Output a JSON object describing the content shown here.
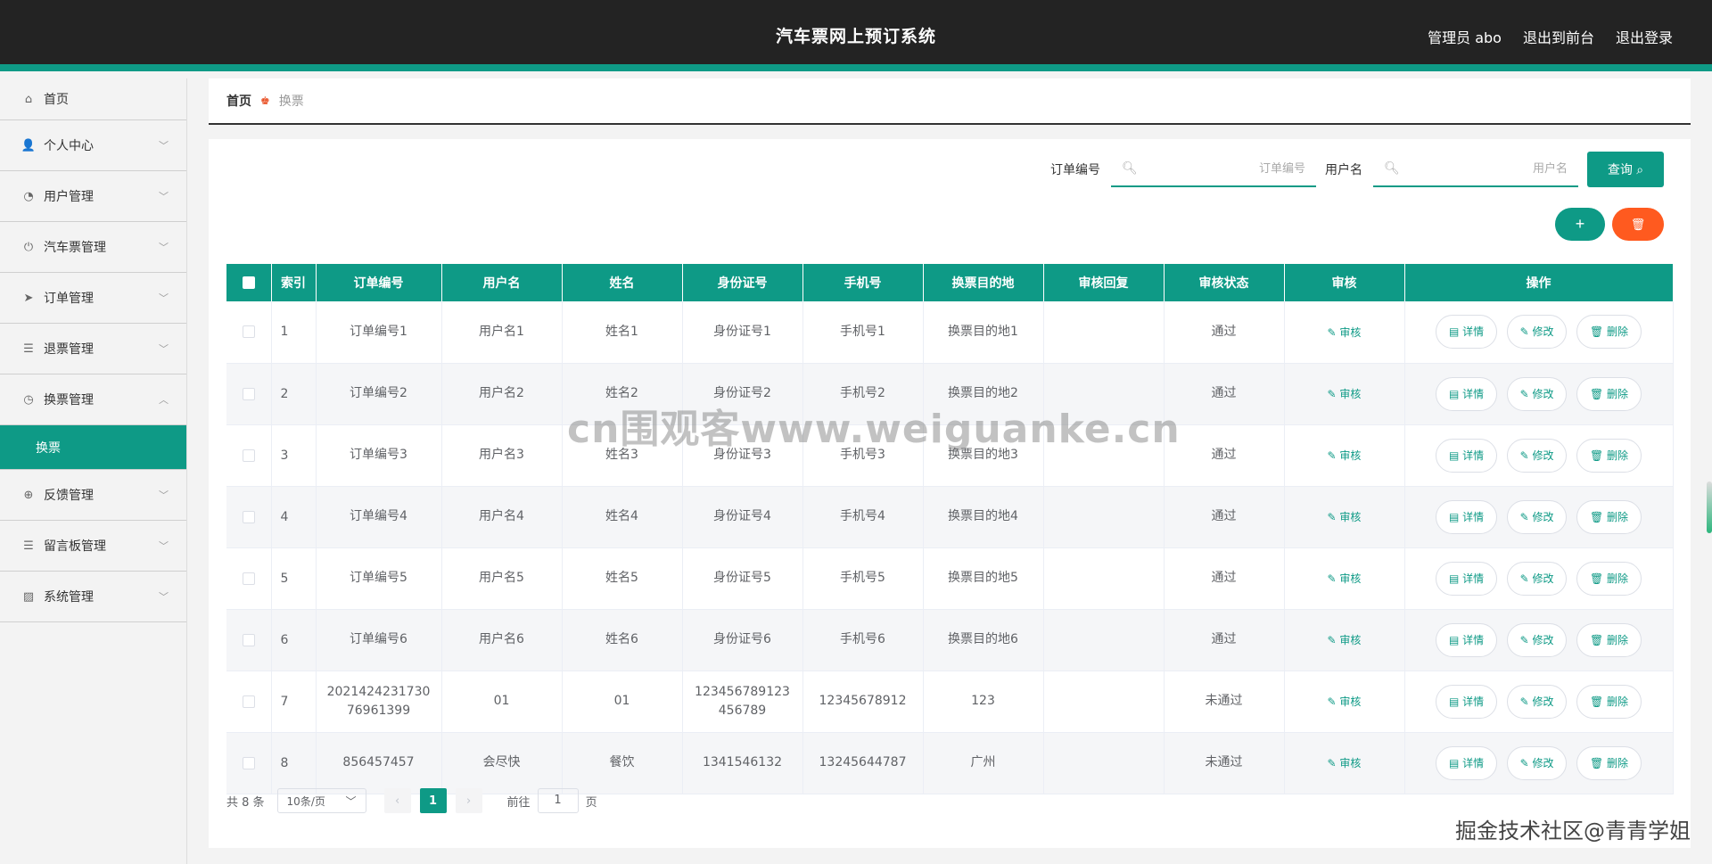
{
  "header": {
    "title": "汽车票网上预订系统",
    "admin": "管理员 abo",
    "to_front": "退出到前台",
    "logout": "退出登录"
  },
  "sidebar": {
    "home": "首页",
    "items": [
      {
        "label": "个人中心",
        "icon": "user-icon"
      },
      {
        "label": "用户管理",
        "icon": "gauge-icon"
      },
      {
        "label": "汽车票管理",
        "icon": "power-icon"
      },
      {
        "label": "订单管理",
        "icon": "send-icon"
      },
      {
        "label": "退票管理",
        "icon": "list-icon"
      },
      {
        "label": "换票管理",
        "icon": "clock-icon"
      }
    ],
    "active_sub": "换票",
    "items_after": [
      {
        "label": "反馈管理",
        "icon": "compass-icon"
      },
      {
        "label": "留言板管理",
        "icon": "list-icon"
      },
      {
        "label": "系统管理",
        "icon": "chart-icon"
      }
    ]
  },
  "breadcrumb": {
    "home": "首页",
    "current": "换票"
  },
  "search": {
    "order_label": "订单编号",
    "order_placeholder": "订单编号",
    "user_label": "用户名",
    "user_placeholder": "用户名",
    "query_label": "查询"
  },
  "table": {
    "headers": [
      "索引",
      "订单编号",
      "用户名",
      "姓名",
      "身份证号",
      "手机号",
      "换票目的地",
      "审核回复",
      "审核状态",
      "审核",
      "操作"
    ],
    "rows": [
      {
        "index": "1",
        "order": "订单编号1",
        "user": "用户名1",
        "name": "姓名1",
        "id": "身份证号1",
        "phone": "手机号1",
        "dest": "换票目的地1",
        "reply": "",
        "status": "通过"
      },
      {
        "index": "2",
        "order": "订单编号2",
        "user": "用户名2",
        "name": "姓名2",
        "id": "身份证号2",
        "phone": "手机号2",
        "dest": "换票目的地2",
        "reply": "",
        "status": "通过"
      },
      {
        "index": "3",
        "order": "订单编号3",
        "user": "用户名3",
        "name": "姓名3",
        "id": "身份证号3",
        "phone": "手机号3",
        "dest": "换票目的地3",
        "reply": "",
        "status": "通过"
      },
      {
        "index": "4",
        "order": "订单编号4",
        "user": "用户名4",
        "name": "姓名4",
        "id": "身份证号4",
        "phone": "手机号4",
        "dest": "换票目的地4",
        "reply": "",
        "status": "通过"
      },
      {
        "index": "5",
        "order": "订单编号5",
        "user": "用户名5",
        "name": "姓名5",
        "id": "身份证号5",
        "phone": "手机号5",
        "dest": "换票目的地5",
        "reply": "",
        "status": "通过"
      },
      {
        "index": "6",
        "order": "订单编号6",
        "user": "用户名6",
        "name": "姓名6",
        "id": "身份证号6",
        "phone": "手机号6",
        "dest": "换票目的地6",
        "reply": "",
        "status": "通过"
      },
      {
        "index": "7",
        "order": "202142423173076961399",
        "user": "01",
        "name": "01",
        "id": "123456789123456789",
        "phone": "12345678912",
        "dest": "123",
        "reply": "",
        "status": "未通过"
      },
      {
        "index": "8",
        "order": "856457457",
        "user": "会尽快",
        "name": "餐饮",
        "id": "1341546132",
        "phone": "13245644787",
        "dest": "广州",
        "reply": "",
        "status": "未通过"
      }
    ],
    "audit_label": "审核",
    "detail_label": "详情",
    "edit_label": "修改",
    "delete_label": "删除"
  },
  "pager": {
    "total": "共 8 条",
    "page_size": "10条/页",
    "current_page": "1",
    "goto_label": "前往",
    "goto_value": "1",
    "page_suffix": "页"
  },
  "watermark": "cn围观客www.weiguanke.cn",
  "corner_mark": "掘金技术社区@青青学姐",
  "colors": {
    "accent": "#0e9a86",
    "danger": "#ff5a1f",
    "header_bg": "#232323"
  }
}
